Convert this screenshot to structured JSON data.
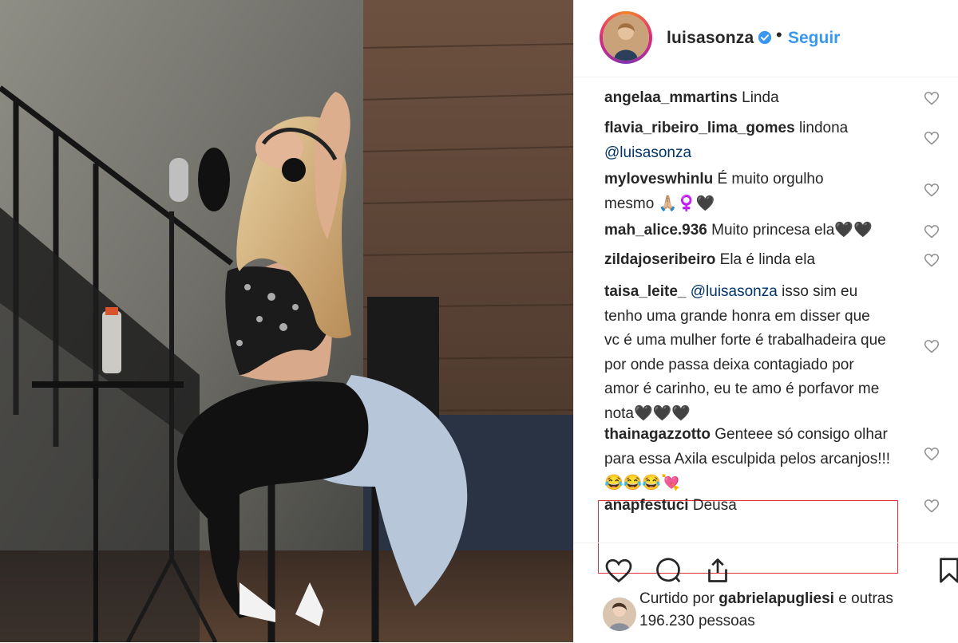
{
  "header": {
    "username": "luisasonza",
    "separator": "•",
    "follow_label": "Seguir"
  },
  "comments": [
    {
      "user": "angelaa_mmartins",
      "text": "Linda"
    },
    {
      "user": "flavia_ribeiro_lima_gomes",
      "text": "lindona",
      "mention": "@luisasonza"
    },
    {
      "user": "myloveswhinlu",
      "text": "É muito orgulho mesmo 🙏🏼‍♀️🖤"
    },
    {
      "user": "mah_alice.936",
      "text": "Muito princesa ela🖤🖤"
    },
    {
      "user": "zildajoseribeiro",
      "text": "Ela é linda ela"
    },
    {
      "user": "taisa_leite_",
      "mention": "@luisasonza",
      "text": "isso sim eu tenho uma grande honra em disser que vc é uma mulher forte é trabalhadeira que por onde passa deixa contagiado por amor é carinho, eu te amo é porfavor me nota🖤🖤🖤"
    },
    {
      "user": "thainagazzotto",
      "text": "Genteee só consigo olhar para essa Axila esculpida pelos arcanjos!!! 😂😂😂💘"
    },
    {
      "user": "anapfestuci",
      "text": "Deusa"
    }
  ],
  "likes": {
    "prefix": "Curtido por",
    "user": "gabrielapugliesi",
    "suffix": "e outras 196.230 pessoas"
  },
  "icons": {
    "like": "heart-icon",
    "comment": "comment-icon",
    "share": "share-icon",
    "save": "bookmark-icon",
    "verified": "verified-badge-icon"
  },
  "colors": {
    "follow": "#3897f0",
    "highlight": "#e0303a",
    "text": "#262626"
  }
}
